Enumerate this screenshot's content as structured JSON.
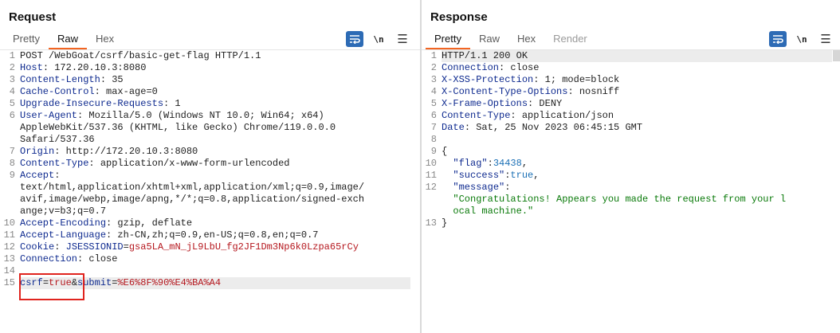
{
  "request": {
    "title": "Request",
    "tabs": [
      {
        "label": "Pretty",
        "active": false
      },
      {
        "label": "Raw",
        "active": true
      },
      {
        "label": "Hex",
        "active": false
      }
    ],
    "newline_label": "\\n",
    "lines": [
      {
        "num": "1",
        "text": "POST /WebGoat/csrf/basic-get-flag HTTP/1.1"
      },
      {
        "num": "2",
        "name": "Host",
        "value": " 172.20.10.3:8080"
      },
      {
        "num": "3",
        "name": "Content-Length",
        "value": " 35"
      },
      {
        "num": "4",
        "name": "Cache-Control",
        "value": " max-age=0"
      },
      {
        "num": "5",
        "name": "Upgrade-Insecure-Requests",
        "value": " 1"
      },
      {
        "num": "6",
        "name": "User-Agent",
        "value": " Mozilla/5.0 (Windows NT 10.0; Win64; x64)"
      },
      {
        "num": "",
        "text": "AppleWebKit/537.36 (KHTML, like Gecko) Chrome/119.0.0.0"
      },
      {
        "num": "",
        "text": "Safari/537.36"
      },
      {
        "num": "7",
        "name": "Origin",
        "value": " http://172.20.10.3:8080"
      },
      {
        "num": "8",
        "name": "Content-Type",
        "value": " application/x-www-form-urlencoded"
      },
      {
        "num": "9",
        "name": "Accept",
        "value": ""
      },
      {
        "num": "",
        "text": "text/html,application/xhtml+xml,application/xml;q=0.9,image/"
      },
      {
        "num": "",
        "text": "avif,image/webp,image/apng,*/*;q=0.8,application/signed-exch"
      },
      {
        "num": "",
        "text": "ange;v=b3;q=0.7"
      },
      {
        "num": "10",
        "name": "Accept-Encoding",
        "value": " gzip, deflate"
      },
      {
        "num": "11",
        "name": "Accept-Language",
        "value": " zh-CN,zh;q=0.9,en-US;q=0.8,en;q=0.7"
      },
      {
        "num": "12",
        "name": "Cookie",
        "cookie_name": "JSESSIONID",
        "cookie_value": "gsa5LA_mN_jL9LbU_fg2JF1Dm3Np6k0Lzpa65rCy"
      },
      {
        "num": "13",
        "name": "Connection",
        "value": " close"
      },
      {
        "num": "14",
        "text": ""
      },
      {
        "num": "15",
        "body": {
          "k1": "csrf",
          "v1": "true",
          "amp": "&",
          "k2": "submit",
          "v2": "%E6%8F%90%E4%BA%A4"
        }
      }
    ]
  },
  "response": {
    "title": "Response",
    "tabs": [
      {
        "label": "Pretty",
        "active": true
      },
      {
        "label": "Raw",
        "active": false
      },
      {
        "label": "Hex",
        "active": false
      },
      {
        "label": "Render",
        "active": false
      }
    ],
    "newline_label": "\\n",
    "lines": [
      {
        "num": "1",
        "text": "HTTP/1.1 200 OK"
      },
      {
        "num": "2",
        "name": "Connection",
        "value": " close"
      },
      {
        "num": "3",
        "name": "X-XSS-Protection",
        "value": " 1; mode=block"
      },
      {
        "num": "4",
        "name": "X-Content-Type-Options",
        "value": " nosniff"
      },
      {
        "num": "5",
        "name": "X-Frame-Options",
        "value": " DENY"
      },
      {
        "num": "6",
        "name": "Content-Type",
        "value": " application/json"
      },
      {
        "num": "7",
        "name": "Date",
        "value": " Sat, 25 Nov 2023 06:45:15 GMT"
      },
      {
        "num": "8",
        "text": ""
      },
      {
        "num": "9",
        "punc": "{"
      },
      {
        "num": "10",
        "jkey": "\"flag\"",
        "jnum": "34438",
        "trail": ","
      },
      {
        "num": "11",
        "jkey": "\"success\"",
        "jnum": "true",
        "trail": ","
      },
      {
        "num": "12",
        "jkey": "\"message\"",
        "trail": ":"
      },
      {
        "num": "",
        "jstr": "\"Congratulations! Appears you made the request from your l"
      },
      {
        "num": "",
        "jstr": "ocal machine.\""
      },
      {
        "num": "13",
        "punc": "}"
      }
    ]
  },
  "colors": {
    "accent": "#f26522",
    "primary": "#2d6bb5",
    "highlight_box": "#e0241e"
  },
  "icons": [
    "wrap-lines-icon",
    "newline-icon",
    "menu-icon",
    "layout-split-horizontal-icon",
    "layout-split-vertical-icon",
    "layout-tabs-icon"
  ]
}
